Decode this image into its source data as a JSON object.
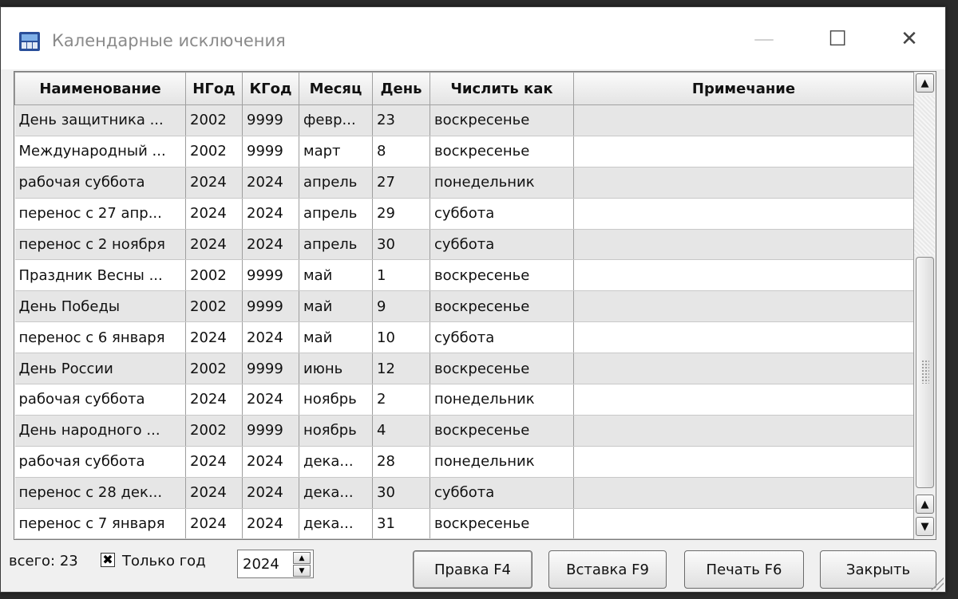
{
  "window": {
    "title": "Календарные исключения",
    "minimize_glyph": "—",
    "maximize_glyph": "☐",
    "close_glyph": "✕"
  },
  "table": {
    "columns": [
      "Наименование",
      "НГод",
      "КГод",
      "Месяц",
      "День",
      "Числить как",
      "Примечание"
    ],
    "rows": [
      [
        "День защитника ...",
        "2002",
        "9999",
        "февр...",
        "23",
        "воскресенье",
        ""
      ],
      [
        "Международный ...",
        "2002",
        "9999",
        "март",
        "8",
        "воскресенье",
        ""
      ],
      [
        "рабочая суббота",
        "2024",
        "2024",
        "апрель",
        "27",
        "понедельник",
        ""
      ],
      [
        "перенос с 27 апр...",
        "2024",
        "2024",
        "апрель",
        "29",
        "суббота",
        ""
      ],
      [
        "перенос с 2 ноября",
        "2024",
        "2024",
        "апрель",
        "30",
        "суббота",
        ""
      ],
      [
        "Праздник Весны ...",
        "2002",
        "9999",
        "май",
        "1",
        "воскресенье",
        ""
      ],
      [
        "День Победы",
        "2002",
        "9999",
        "май",
        "9",
        "воскресенье",
        ""
      ],
      [
        "перенос с 6 января",
        "2024",
        "2024",
        "май",
        "10",
        "суббота",
        ""
      ],
      [
        "День России",
        "2002",
        "9999",
        "июнь",
        "12",
        "воскресенье",
        ""
      ],
      [
        "рабочая суббота",
        "2024",
        "2024",
        "ноябрь",
        "2",
        "понедельник",
        ""
      ],
      [
        "День народного ...",
        "2002",
        "9999",
        "ноябрь",
        "4",
        "воскресенье",
        ""
      ],
      [
        "рабочая суббота",
        "2024",
        "2024",
        "дека...",
        "28",
        "понедельник",
        ""
      ],
      [
        "перенос с 28 дек...",
        "2024",
        "2024",
        "дека...",
        "30",
        "суббота",
        ""
      ],
      [
        "перенос с 7 января",
        "2024",
        "2024",
        "дека...",
        "31",
        "воскресенье",
        ""
      ]
    ]
  },
  "footer": {
    "total_text": "всего: 23",
    "only_year_checked": true,
    "check_glyph": "✖",
    "only_year_label": "Только год",
    "year_value": "2024",
    "buttons": {
      "edit": "Правка F4",
      "insert": "Вставка F9",
      "print": "Печать F6",
      "close": "Закрыть"
    }
  },
  "icons": {
    "app": "app-icon",
    "scroll_up": "▲",
    "scroll_down": "▼"
  }
}
